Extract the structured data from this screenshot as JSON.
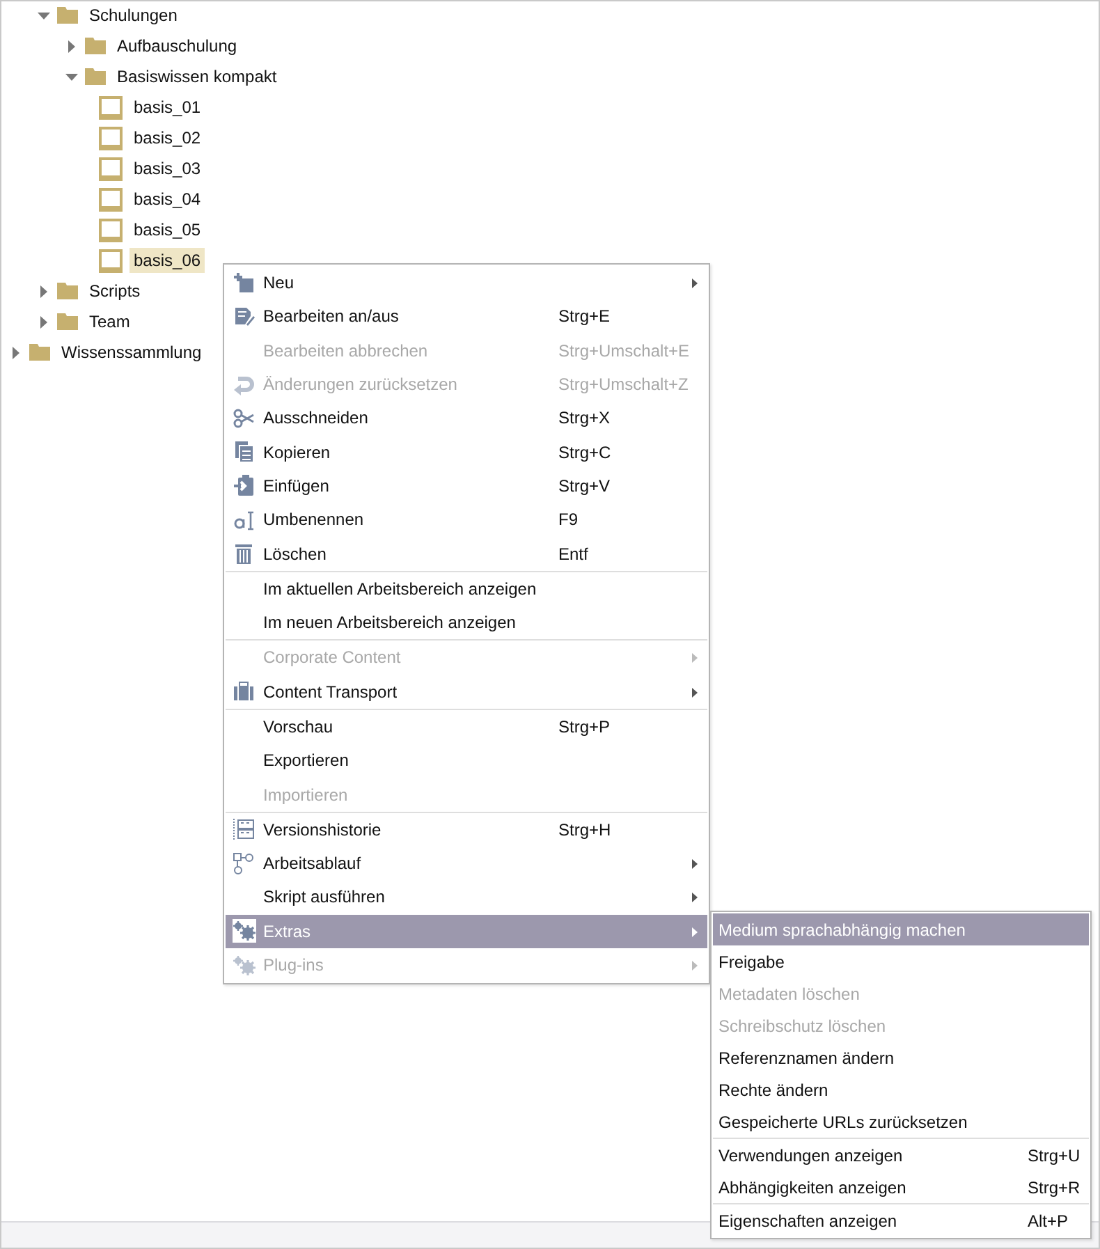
{
  "tree": {
    "cut_off_branch": [
      {
        "label": "Schulungen",
        "kind": "folder",
        "expanded": true,
        "selected": false,
        "children": [
          {
            "label": "Aufbauschulung",
            "kind": "folder",
            "expanded": false,
            "selected": false
          },
          {
            "label": "Basiswissen kompakt",
            "kind": "folder",
            "expanded": true,
            "selected": false,
            "children": [
              {
                "label": "basis_01",
                "kind": "medium",
                "selected": false
              },
              {
                "label": "basis_02",
                "kind": "medium",
                "selected": false
              },
              {
                "label": "basis_03",
                "kind": "medium",
                "selected": false
              },
              {
                "label": "basis_04",
                "kind": "medium",
                "selected": false
              },
              {
                "label": "basis_05",
                "kind": "medium",
                "selected": false
              },
              {
                "label": "basis_06",
                "kind": "medium",
                "selected": true
              }
            ]
          }
        ]
      },
      {
        "label": "Scripts",
        "kind": "folder",
        "expanded": false,
        "selected": false
      },
      {
        "label": "Team",
        "kind": "folder",
        "expanded": false,
        "selected": false
      }
    ],
    "items": [
      {
        "label": "Wissenssammlung",
        "kind": "folder",
        "expanded": false,
        "selected": false
      }
    ]
  },
  "context_menu": {
    "items": [
      {
        "kind": "item",
        "label": "Neu",
        "submenu": true,
        "disabled": false,
        "selected": false
      },
      {
        "kind": "item",
        "label": "Bearbeiten an/aus",
        "shortcut": "Strg+E",
        "disabled": false,
        "selected": false
      },
      {
        "kind": "item",
        "label": "Bearbeiten abbrechen",
        "shortcut": "Strg+Umschalt+E",
        "disabled": true,
        "selected": false
      },
      {
        "kind": "item",
        "label": "Änderungen zurücksetzen",
        "shortcut": "Strg+Umschalt+Z",
        "disabled": true,
        "selected": false
      },
      {
        "kind": "item",
        "label": "Ausschneiden",
        "shortcut": "Strg+X",
        "disabled": false,
        "selected": false
      },
      {
        "kind": "item",
        "label": "Kopieren",
        "shortcut": "Strg+C",
        "disabled": false,
        "selected": false
      },
      {
        "kind": "item",
        "label": "Einfügen",
        "shortcut": "Strg+V",
        "disabled": false,
        "selected": false
      },
      {
        "kind": "item",
        "label": "Umbenennen",
        "shortcut": "F9",
        "disabled": false,
        "selected": false
      },
      {
        "kind": "item",
        "label": "Löschen",
        "shortcut": "Entf",
        "disabled": false,
        "selected": false
      },
      {
        "kind": "separator"
      },
      {
        "kind": "item",
        "label": "Im aktuellen Arbeitsbereich anzeigen",
        "disabled": false,
        "selected": false
      },
      {
        "kind": "item",
        "label": "Im neuen Arbeitsbereich anzeigen",
        "disabled": false,
        "selected": false
      },
      {
        "kind": "separator"
      },
      {
        "kind": "item",
        "label": "Corporate Content",
        "submenu": true,
        "disabled": true,
        "selected": false
      },
      {
        "kind": "item",
        "label": "Content Transport",
        "submenu": true,
        "disabled": false,
        "selected": false
      },
      {
        "kind": "separator"
      },
      {
        "kind": "item",
        "label": "Vorschau",
        "shortcut": "Strg+P",
        "disabled": false,
        "selected": false
      },
      {
        "kind": "item",
        "label": "Exportieren",
        "disabled": false,
        "selected": false
      },
      {
        "kind": "item",
        "label": "Importieren",
        "disabled": true,
        "selected": false
      },
      {
        "kind": "separator"
      },
      {
        "kind": "item",
        "label": "Versionshistorie",
        "shortcut": "Strg+H",
        "disabled": false,
        "selected": false
      },
      {
        "kind": "item",
        "label": "Arbeitsablauf",
        "submenu": true,
        "disabled": false,
        "selected": false
      },
      {
        "kind": "item",
        "label": "Skript ausführen",
        "submenu": true,
        "disabled": false,
        "selected": false
      },
      {
        "kind": "item",
        "label": "Extras",
        "submenu": true,
        "disabled": false,
        "selected": true
      },
      {
        "kind": "item",
        "label": "Plug-ins",
        "submenu": true,
        "disabled": true,
        "selected": false
      }
    ]
  },
  "submenu": {
    "items": [
      {
        "kind": "item",
        "label": "Medium sprachabhängig machen",
        "disabled": false,
        "selected": true
      },
      {
        "kind": "item",
        "label": "Freigabe",
        "disabled": false,
        "selected": false
      },
      {
        "kind": "item",
        "label": "Metadaten löschen",
        "disabled": true,
        "selected": false
      },
      {
        "kind": "item",
        "label": "Schreibschutz löschen",
        "disabled": true,
        "selected": false
      },
      {
        "kind": "item",
        "label": "Referenznamen ändern",
        "disabled": false,
        "selected": false
      },
      {
        "kind": "item",
        "label": "Rechte ändern",
        "disabled": false,
        "selected": false
      },
      {
        "kind": "item",
        "label": "Gespeicherte URLs zurücksetzen",
        "disabled": false,
        "selected": false
      },
      {
        "kind": "separator"
      },
      {
        "kind": "item",
        "label": "Verwendungen anzeigen",
        "shortcut": "Strg+U",
        "disabled": false,
        "selected": false
      },
      {
        "kind": "item",
        "label": "Abhängigkeiten anzeigen",
        "shortcut": "Strg+R",
        "disabled": false,
        "selected": false
      },
      {
        "kind": "separator"
      },
      {
        "kind": "item",
        "label": "Eigenschaften anzeigen",
        "shortcut": "Alt+P",
        "disabled": false,
        "selected": false
      }
    ]
  }
}
